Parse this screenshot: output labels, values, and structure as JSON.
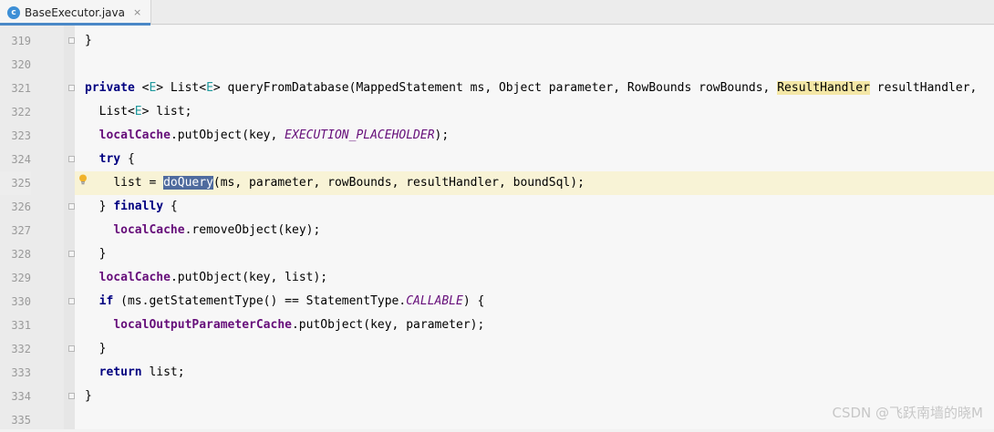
{
  "tab": {
    "filename": "BaseExecutor.java",
    "icon_letter": "c",
    "close_glyph": "×"
  },
  "lines": [
    {
      "num": "319",
      "indent": "",
      "tokens": [
        {
          "t": "}"
        }
      ]
    },
    {
      "num": "320",
      "indent": "",
      "tokens": []
    },
    {
      "num": "321",
      "indent": "",
      "tokens": [
        {
          "t": "private",
          "c": "kw"
        },
        {
          "t": " "
        },
        {
          "t": "<"
        },
        {
          "t": "E",
          "c": "tp"
        },
        {
          "t": "> List<"
        },
        {
          "t": "E",
          "c": "tp"
        },
        {
          "t": "> queryFromDatabase(MappedStatement ms, Object parameter, RowBounds rowBounds, "
        },
        {
          "t": "ResultHandler",
          "c": "hl"
        },
        {
          "t": " resultHandler,"
        }
      ]
    },
    {
      "num": "322",
      "indent": "  ",
      "tokens": [
        {
          "t": "List<"
        },
        {
          "t": "E",
          "c": "tp"
        },
        {
          "t": "> list;"
        }
      ]
    },
    {
      "num": "323",
      "indent": "  ",
      "tokens": [
        {
          "t": "localCache",
          "c": "fld"
        },
        {
          "t": ".putObject(key, "
        },
        {
          "t": "EXECUTION_PLACEHOLDER",
          "c": "cst"
        },
        {
          "t": ");"
        }
      ]
    },
    {
      "num": "324",
      "indent": "  ",
      "tokens": [
        {
          "t": "try",
          "c": "kw"
        },
        {
          "t": " {"
        }
      ]
    },
    {
      "num": "325",
      "indent": "    ",
      "current": true,
      "tokens": [
        {
          "t": "list = "
        },
        {
          "t": "doQuery",
          "c": "sel"
        },
        {
          "t": "(ms, parameter, rowBounds, resultHandler, boundSql);"
        }
      ]
    },
    {
      "num": "326",
      "indent": "  ",
      "tokens": [
        {
          "t": "} "
        },
        {
          "t": "finally",
          "c": "kw"
        },
        {
          "t": " {"
        }
      ]
    },
    {
      "num": "327",
      "indent": "    ",
      "tokens": [
        {
          "t": "localCache",
          "c": "fld"
        },
        {
          "t": ".removeObject(key);"
        }
      ]
    },
    {
      "num": "328",
      "indent": "  ",
      "tokens": [
        {
          "t": "}"
        }
      ]
    },
    {
      "num": "329",
      "indent": "  ",
      "tokens": [
        {
          "t": "localCache",
          "c": "fld"
        },
        {
          "t": ".putObject(key, list);"
        }
      ]
    },
    {
      "num": "330",
      "indent": "  ",
      "tokens": [
        {
          "t": "if",
          "c": "kw"
        },
        {
          "t": " (ms.getStatementType() == StatementType."
        },
        {
          "t": "CALLABLE",
          "c": "cst"
        },
        {
          "t": ") {"
        }
      ]
    },
    {
      "num": "331",
      "indent": "    ",
      "tokens": [
        {
          "t": "localOutputParameterCache",
          "c": "fld"
        },
        {
          "t": ".putObject(key, parameter);"
        }
      ]
    },
    {
      "num": "332",
      "indent": "  ",
      "tokens": [
        {
          "t": "}"
        }
      ]
    },
    {
      "num": "333",
      "indent": "  ",
      "tokens": [
        {
          "t": "return",
          "c": "kw"
        },
        {
          "t": " list;"
        }
      ]
    },
    {
      "num": "334",
      "indent": "",
      "tokens": [
        {
          "t": "}"
        }
      ]
    },
    {
      "num": "335",
      "indent": "",
      "tokens": []
    }
  ],
  "fold_markers": [
    "319",
    "321",
    "324",
    "326",
    "328",
    "330",
    "332",
    "334"
  ],
  "intention_bulb_icon": "lightbulb-icon",
  "watermark": "CSDN @飞跃南墙的晓M",
  "colors": {
    "keyword": "#000080",
    "field": "#660e7a",
    "type_param": "#20999d",
    "selection": "#4f6b9e",
    "highlight": "#f4e7a6",
    "current_line": "#f8f3d6"
  }
}
